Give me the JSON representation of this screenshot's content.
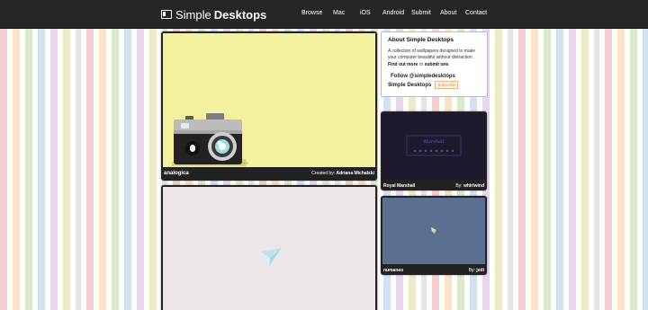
{
  "header": {
    "logo_text": "Simple",
    "logo_bold": "Desktops",
    "nav": [
      "Browse",
      "Mac",
      "iOS",
      "Android",
      "Submit",
      "About",
      "Contact"
    ]
  },
  "about": {
    "title": "About Simple Desktops",
    "text_1": "A collection of wallpapers designed to make your computer beautiful without distraction. ",
    "link_more": "Find out more",
    "text_2": " or ",
    "link_submit": "submit one",
    "text_3": ".",
    "follow": "Follow @simpledesktops",
    "brand": "Simple Desktops",
    "subscribe": "Subscribe"
  },
  "wallpapers": [
    {
      "title": "analogica",
      "credit_prefix": "Created by: ",
      "author": "Adriana Michalski",
      "bg": "#f4f19e"
    },
    {
      "title": "",
      "credit_prefix": "",
      "author": "",
      "bg": "#ece7e6"
    },
    {
      "title": "Royal Marshall",
      "credit_prefix": "By: ",
      "author": "whirlwind",
      "bg": "#1f1930"
    },
    {
      "title": "numaneo",
      "credit_prefix": "By: ",
      "author": "jedi",
      "bg": "#5a6f92"
    }
  ]
}
